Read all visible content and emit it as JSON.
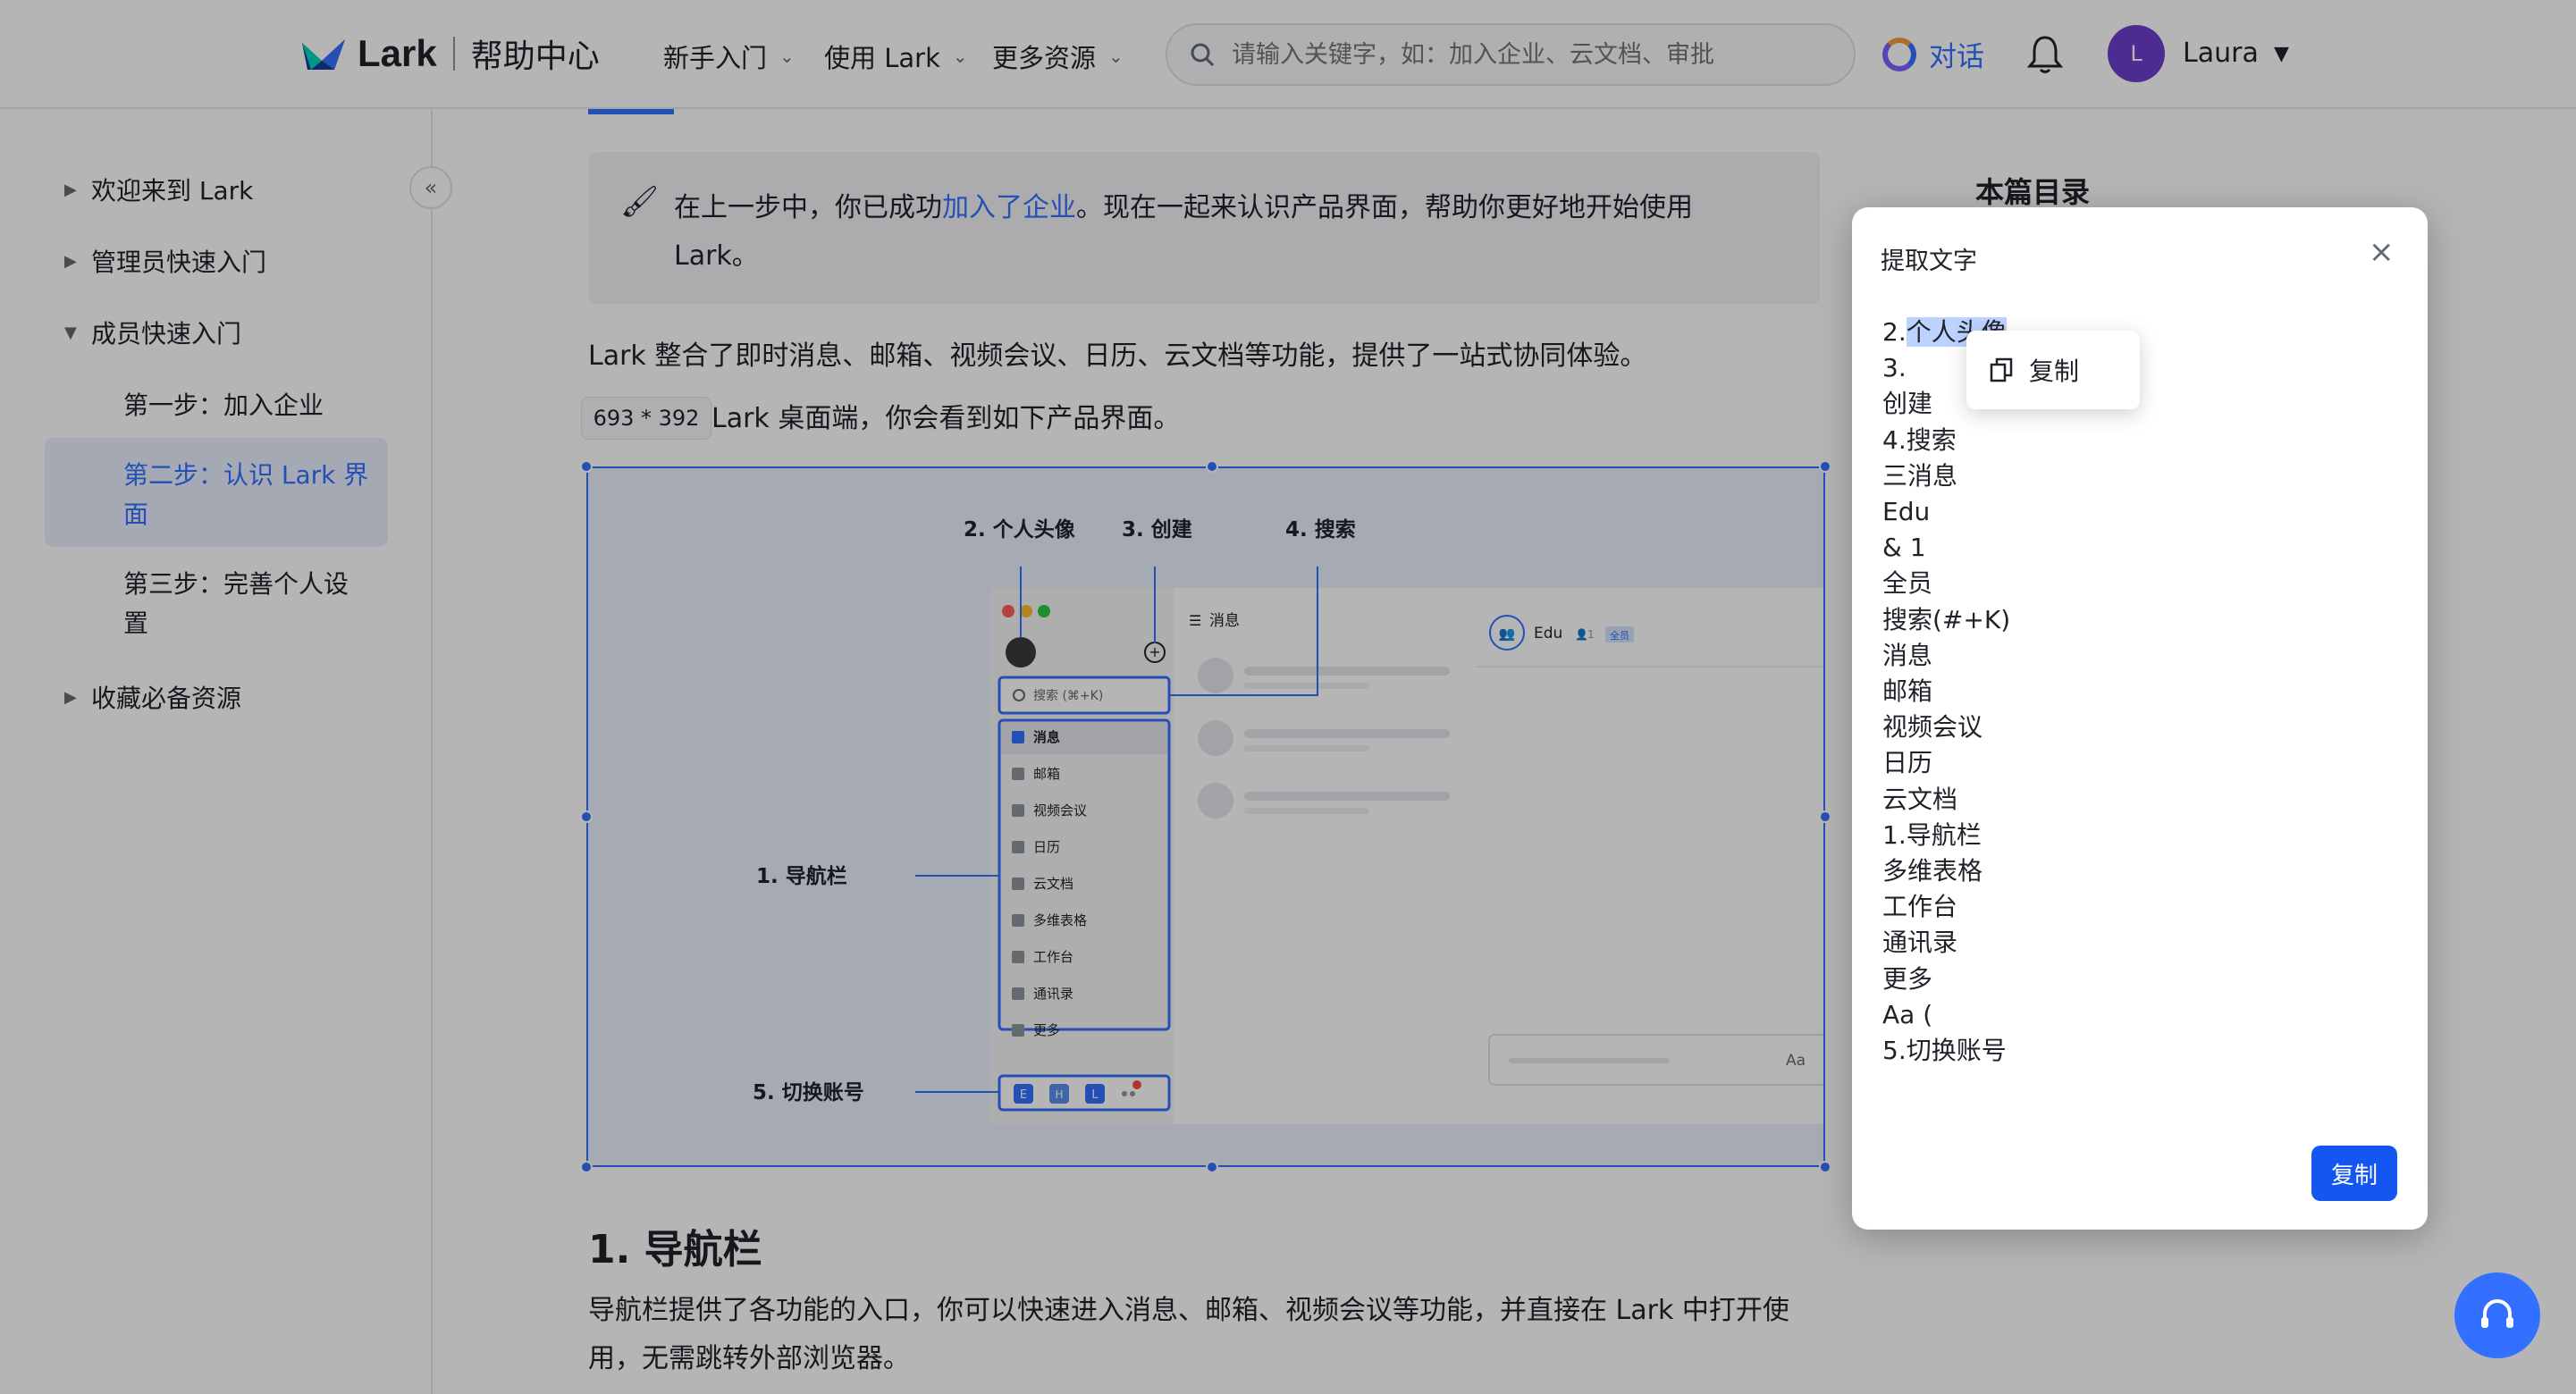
{
  "header": {
    "logo_text": "Lark",
    "help_center": "帮助中心",
    "nav": [
      "新手入门",
      "使用 Lark",
      "更多资源"
    ],
    "search_placeholder": "请输入关键字，如：加入企业、云文档、审批",
    "chat_label": "对话",
    "user_initial": "L",
    "user_name": "Laura"
  },
  "sidebar": {
    "items": [
      {
        "label": "欢迎来到 Lark",
        "expanded": false
      },
      {
        "label": "管理员快速入门",
        "expanded": false
      },
      {
        "label": "成员快速入门",
        "expanded": true
      },
      {
        "label": "第一步：加入企业",
        "child": true
      },
      {
        "label_line1": "第二步：认识 Lark 界",
        "label_line2": "面",
        "child": true,
        "active": true
      },
      {
        "label_line1": "第三步：完善个人设",
        "label_line2": "置",
        "child": true
      },
      {
        "label": "收藏必备资源",
        "expanded": false
      }
    ]
  },
  "content": {
    "callout_before": "在上一步中，你已成功",
    "callout_link": "加入了企业",
    "callout_after": "。现在一起来认识产品界面，帮助你更好地开始使用",
    "callout_line2": "Lark。",
    "intro": "Lark 整合了即时消息、邮箱、视频会议、日历、云文档等功能，提供了一站式协同体验。",
    "intro2": "Lark 桌面端，你会看到如下产品界面。",
    "dim_badge": "693 * 392",
    "heading": "1. 导航栏",
    "nav_desc": "导航栏提供了各功能的入口，你可以快速进入消息、邮箱、视频会议等功能，并直接在 Lark 中打开使用，无需跳转外部浏览器。",
    "toc_title": "本篇目录"
  },
  "figure": {
    "labels": {
      "avatar": "2. 个人头像",
      "create": "3. 创建",
      "search": "4. 搜索",
      "navbar": "1. 导航栏",
      "switch": "5. 切换账号"
    },
    "search_box": "搜索 (⌘+K)",
    "nav_items": [
      "消息",
      "邮箱",
      "视频会议",
      "日历",
      "云文档",
      "多维表格",
      "工作台",
      "通讯录",
      "更多"
    ],
    "messages_title": "消息",
    "chat_name": "Edu",
    "chat_members": "1",
    "chat_badge": "全员",
    "input_font_icon": "Aa",
    "account_letters": [
      "E",
      "H",
      "L"
    ]
  },
  "dialog": {
    "title": "提取文字",
    "line_first_prefix": "2.",
    "line_first_selected": "个人头像",
    "lines": [
      "3.",
      "创建",
      "4.搜索",
      "三消息",
      "Edu",
      "& 1",
      "全员",
      "搜索(#+K)",
      "消息",
      "邮箱",
      "视频会议",
      "日历",
      "云文档",
      "1.导航栏",
      "多维表格",
      "工作台",
      "通讯录",
      "更多",
      "Aa (",
      "5.切换账号"
    ],
    "context_copy": "复制",
    "copy_button": "复制"
  },
  "colors": {
    "accent": "#3370ff",
    "button_primary": "#1456f0",
    "overlay": "rgba(0,0,0,0.29)"
  }
}
